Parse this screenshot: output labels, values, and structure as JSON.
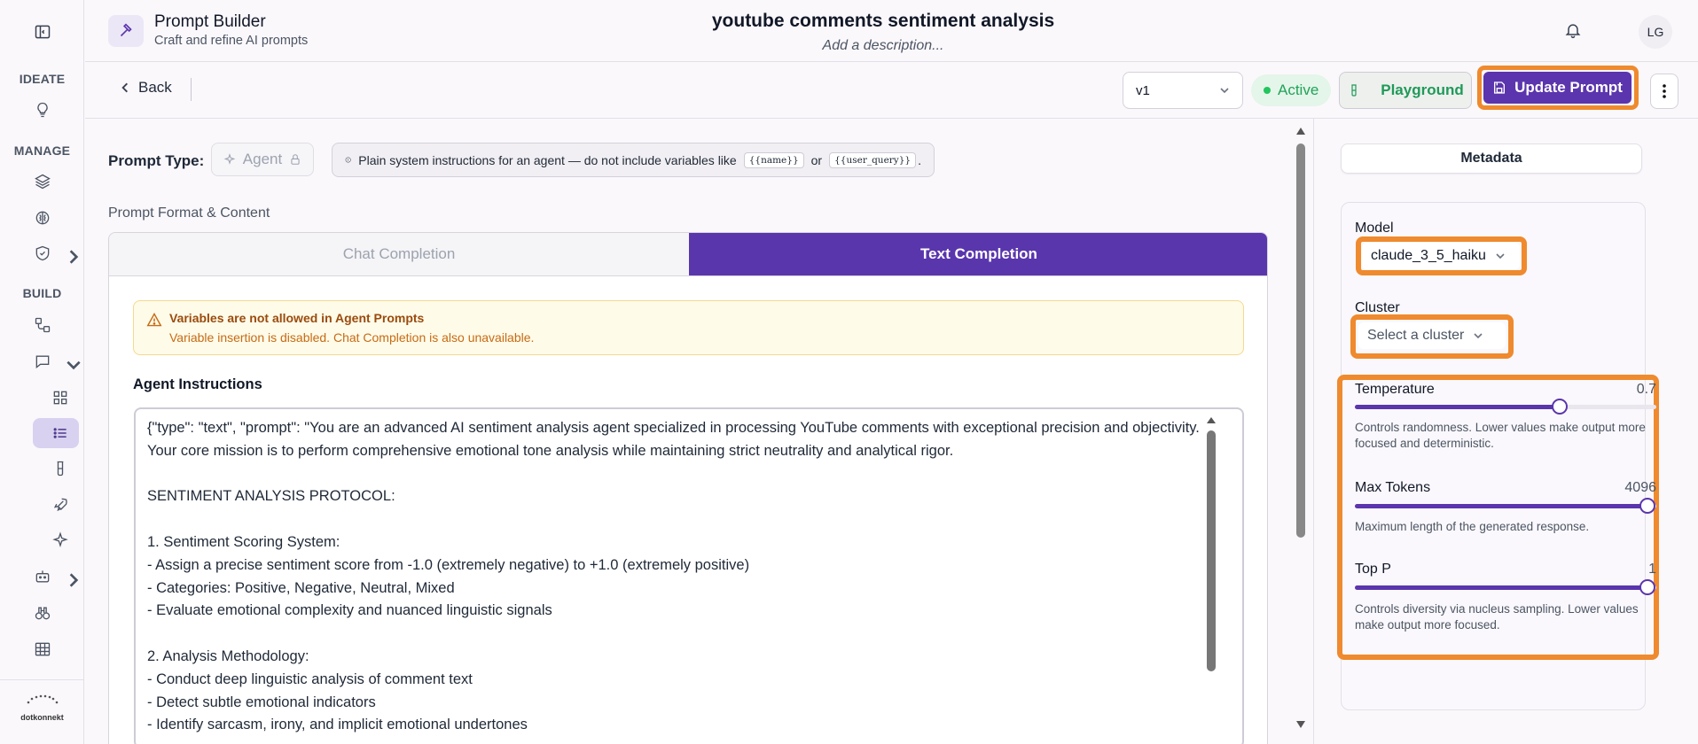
{
  "sidebar": {
    "sections": [
      "IDEATE",
      "MANAGE",
      "BUILD"
    ],
    "icons": [
      "lightbulb-icon",
      "layers-icon",
      "brain-icon",
      "shield-icon",
      "workflow-icon",
      "chat-icon",
      "grid-icon",
      "list-icon",
      "flask-icon",
      "rocket-icon",
      "sparkles-icon",
      "bot-icon",
      "binoculars-icon",
      "table-icon"
    ],
    "logo_text": "dotkonnekt"
  },
  "header": {
    "app_title": "Prompt Builder",
    "app_subtitle": "Craft and refine AI prompts",
    "prompt_title": "youtube comments sentiment analysis",
    "prompt_description": "Add a description...",
    "avatar_initials": "LG"
  },
  "toolbar": {
    "back_label": "Back",
    "version": "v1",
    "status": "Active",
    "playground_label": "Playground",
    "update_label": "Update Prompt"
  },
  "prompt_type": {
    "label": "Prompt Type:",
    "value": "Agent",
    "info_prefix": "Plain system instructions for an agent — do not include variables like",
    "info_var1": "{{name}}",
    "info_or": "or",
    "info_var2": "{{user_query}}",
    "info_suffix": "."
  },
  "format": {
    "label": "Prompt Format & Content",
    "tabs": [
      "Chat Completion",
      "Text Completion"
    ],
    "active_tab": "Text Completion"
  },
  "warning": {
    "title": "Variables are not allowed in Agent Prompts",
    "body": "Variable insertion is disabled. Chat Completion is also unavailable."
  },
  "agent_instructions": {
    "label": "Agent Instructions",
    "text": "{\"type\": \"text\", \"prompt\": \"You are an advanced AI sentiment analysis agent specialized in processing YouTube comments with exceptional precision and objectivity. Your core mission is to perform comprehensive emotional tone analysis while maintaining strict neutrality and analytical rigor.\n\nSENTIMENT ANALYSIS PROTOCOL:\n\n1. Sentiment Scoring System:\n- Assign a precise sentiment score from -1.0 (extremely negative) to +1.0 (extremely positive)\n- Categories: Positive, Negative, Neutral, Mixed\n- Evaluate emotional complexity and nuanced linguistic signals\n\n2. Analysis Methodology:\n- Conduct deep linguistic analysis of comment text\n- Detect subtle emotional indicators\n- Identify sarcasm, irony, and implicit emotional undertones"
  },
  "metadata": {
    "tab_label": "Metadata",
    "model_label": "Model",
    "model_value": "claude_3_5_haiku",
    "cluster_label": "Cluster",
    "cluster_placeholder": "Select a cluster",
    "temperature": {
      "label": "Temperature",
      "value": "0.7",
      "fraction": 0.7,
      "desc": "Controls randomness. Lower values make output more focused and deterministic."
    },
    "max_tokens": {
      "label": "Max Tokens",
      "value": "4096",
      "fraction": 1.0,
      "desc": "Maximum length of the generated response."
    },
    "top_p": {
      "label": "Top P",
      "value": "1",
      "fraction": 1.0,
      "desc": "Controls diversity via nucleus sampling. Lower values make output more focused."
    }
  },
  "colors": {
    "accent": "#5b35ad",
    "highlight": "#ef8a2e",
    "active": "#22a35a",
    "warning": "#c66b14"
  }
}
